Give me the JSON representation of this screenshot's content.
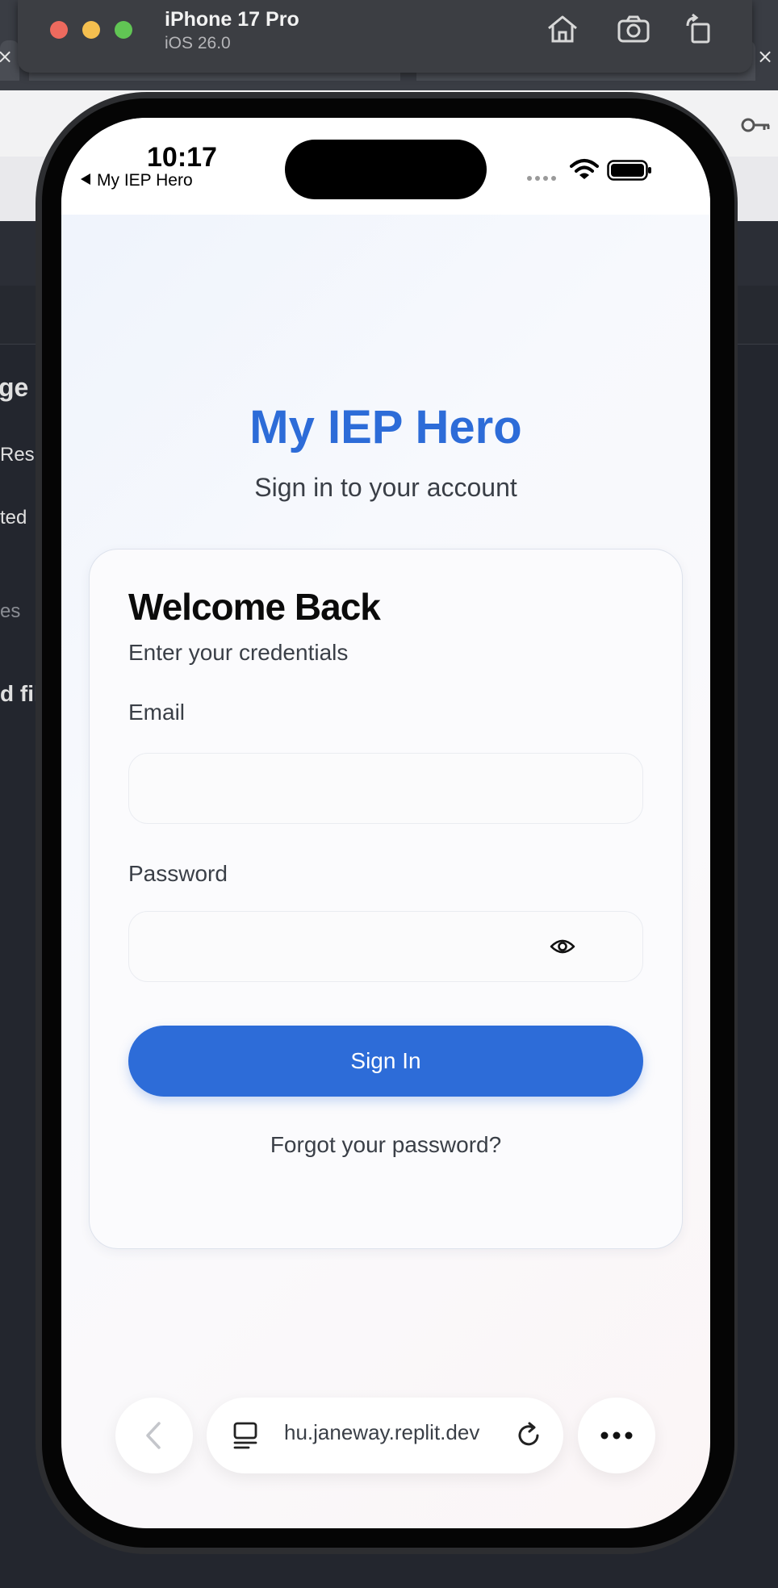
{
  "simulator": {
    "device_name": "iPhone 17 Pro",
    "os_version": "iOS 26.0",
    "icons": [
      "home-icon",
      "screenshot-icon",
      "rotate-icon"
    ],
    "traffic_lights": {
      "close": "#ed6a5e",
      "minimize": "#f5bf4f",
      "zoom": "#61c554"
    }
  },
  "background_window": {
    "fragments": [
      "ge",
      "Res",
      "ted",
      "es",
      "d fil"
    ]
  },
  "status_bar": {
    "time": "10:17",
    "back_app": "My IEP Hero"
  },
  "page": {
    "brand_title": "My IEP Hero",
    "tagline": "Sign in to your account",
    "brand_color": "#2d6cd8"
  },
  "login_card": {
    "title": "Welcome Back",
    "subtitle": "Enter your credentials",
    "email_label": "Email",
    "email_value": "",
    "password_label": "Password",
    "password_value": "",
    "show_password_icon": "eye-icon",
    "submit_label": "Sign In",
    "forgot_link": "Forgot your password?"
  },
  "browser_toolbar": {
    "url": "hu.janeway.replit.dev",
    "icons": [
      "back-chevron-icon",
      "tabs-icon",
      "reload-icon",
      "more-icon"
    ]
  }
}
